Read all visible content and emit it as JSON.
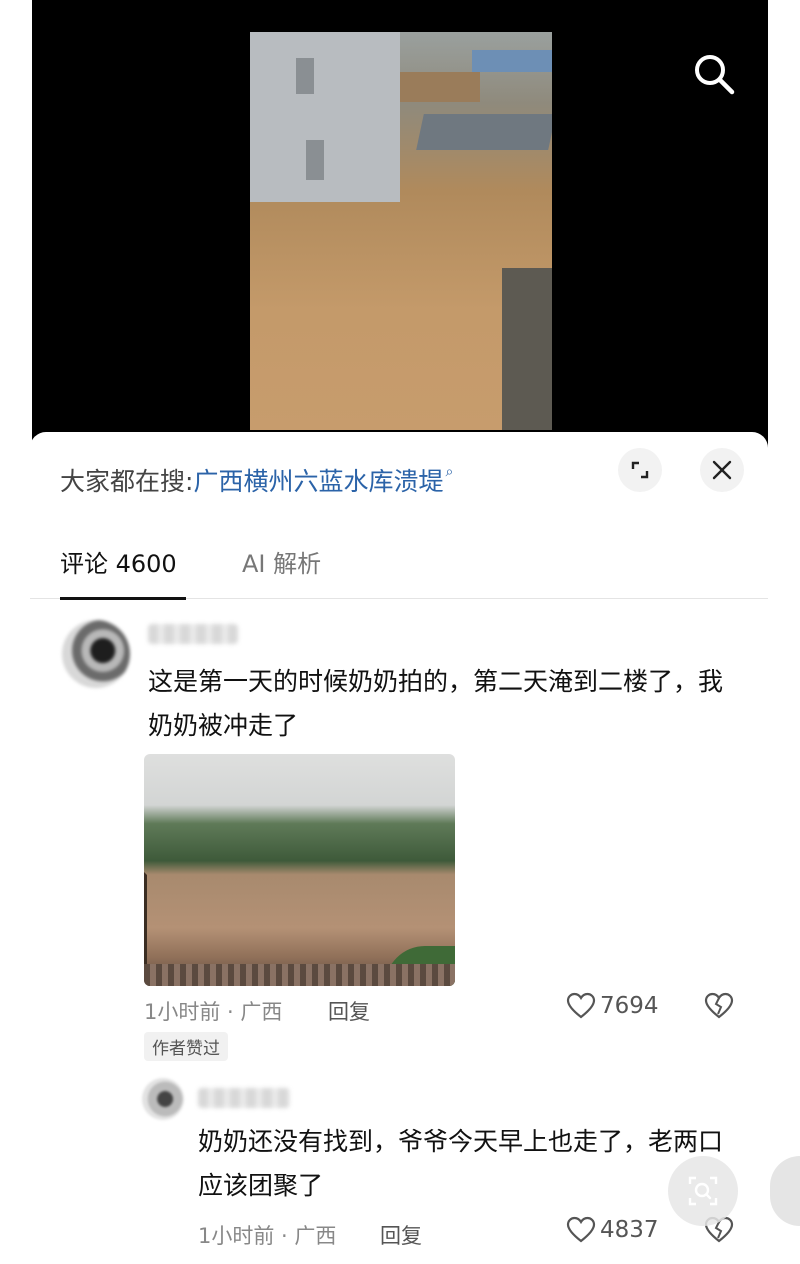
{
  "hot_search": {
    "prefix": "大家都在搜:",
    "query": "广西横州六蓝水库溃堤"
  },
  "tabs": [
    {
      "label": "评论 4600",
      "active": true
    },
    {
      "label": "AI 解析",
      "active": false
    }
  ],
  "comments": [
    {
      "text": "这是第一天的时候奶奶拍的，第二天淹到二楼了，我奶奶被冲走了",
      "time_location": "1小时前 · 广西",
      "reply_label": "回复",
      "likes": "7694",
      "badge": "作者赞过"
    }
  ],
  "replies": [
    {
      "text": "奶奶还没有找到，爷爷今天早上也走了，老两口应该团聚了",
      "time_location": "1小时前 · 广西",
      "reply_label": "回复",
      "likes": "4837"
    }
  ],
  "icons": {
    "search": "search-icon",
    "expand": "expand-icon",
    "close": "close-icon",
    "like": "heart-icon",
    "dislike": "broken-heart-icon",
    "visual_search": "visual-search-icon"
  },
  "colors": {
    "link": "#2b63a8",
    "sheet_bg": "#ffffff",
    "video_bg": "#000000"
  }
}
